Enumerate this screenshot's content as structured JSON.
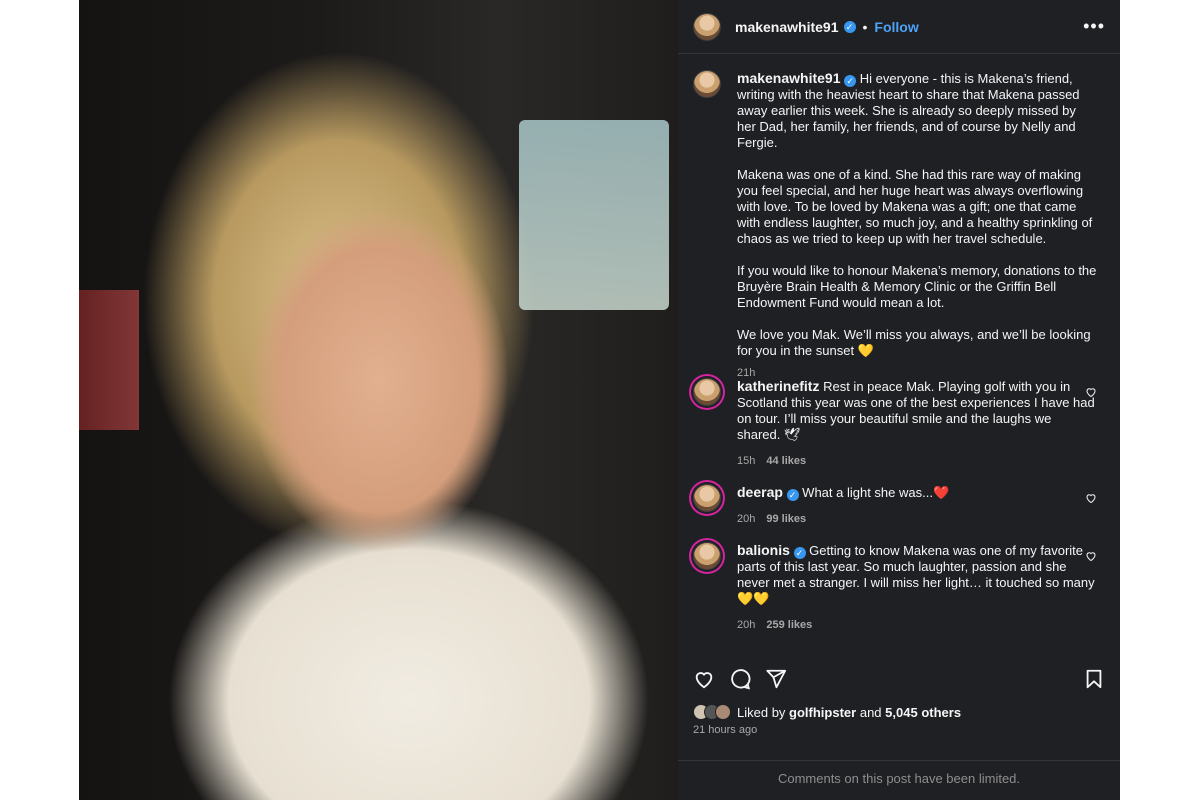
{
  "header": {
    "username": "makenawhite91",
    "follow_label": "Follow",
    "separator": "•",
    "more_label": "•••"
  },
  "caption": {
    "username": "makenawhite91",
    "paragraphs": [
      "Hi everyone - this is Makena’s friend, writing with the heaviest heart to share that Makena passed away earlier this week. She is already so deeply missed by her Dad, her family, her friends, and of course by Nelly and Fergie.",
      "Makena was one of a kind. She had this rare way of making you feel special, and her huge heart was always overflowing with love. To be loved by Makena was a gift; one that came with endless laughter, so much joy, and a healthy sprinkling of chaos as we tried to keep up with her travel schedule.",
      "If you would like to honour Makena’s memory, donations to the Bruyère Brain Health & Memory Clinic or the Griffin Bell Endowment Fund would mean a lot.",
      "We love you Mak. We’ll miss you always, and we’ll be looking for you in the sunset 💛"
    ],
    "time": "21h"
  },
  "comments": [
    {
      "username": "katherinefitz",
      "verified": false,
      "text": "Rest in peace Mak. Playing golf with you in Scotland this year was one of the best experiences I have had on tour. I’ll miss your beautiful smile and the laughs we shared. 🕊",
      "time": "15h",
      "likes": "44 likes"
    },
    {
      "username": "deerap",
      "verified": true,
      "text": "What a light she was...❤️",
      "time": "20h",
      "likes": "99 likes"
    },
    {
      "username": "balionis",
      "verified": true,
      "text": "Getting to know Makena was one of my favorite parts of this last year. So much laughter, passion and she never met a stranger. I will miss her light… it touched so many💛💛",
      "time": "20h",
      "likes": "259 likes"
    }
  ],
  "likes": {
    "prefix": "Liked by",
    "user": "golfhipster",
    "and": "and",
    "others": "5,045 others"
  },
  "post_time": "21 hours ago",
  "comments_limited": "Comments on this post have been limited.",
  "colors": {
    "panel_bg": "#1f2024",
    "follow": "#4ca2f5",
    "verified": "#3897f0",
    "muted": "#a8a8a8"
  }
}
